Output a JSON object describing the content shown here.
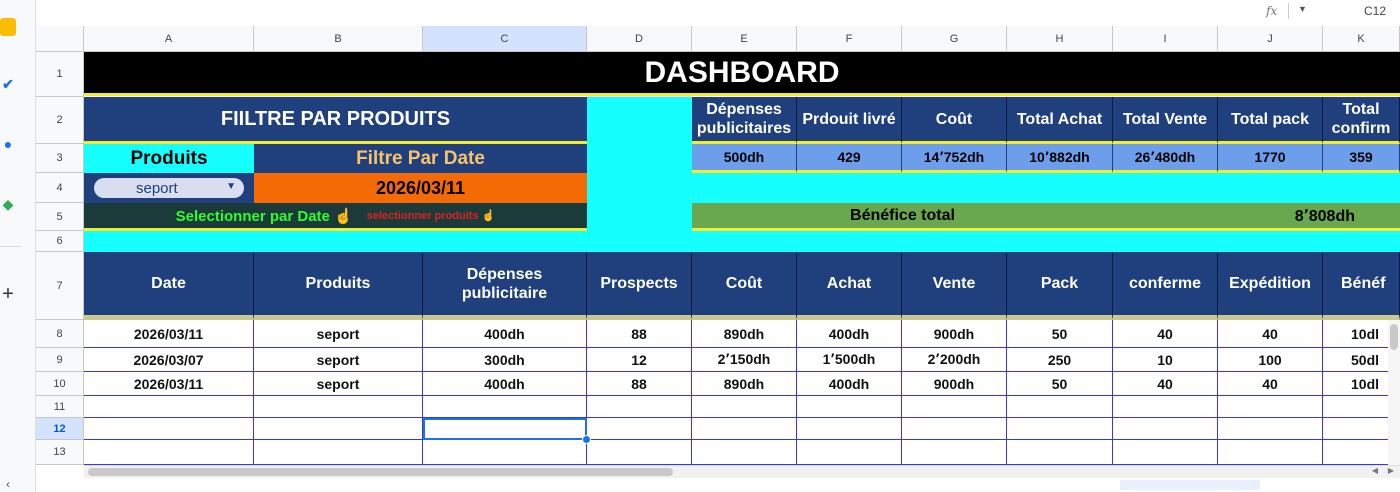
{
  "toolbar": {
    "fx_label": "fx",
    "cell_ref": "C12"
  },
  "sidebar": {
    "icons": [
      "keep-icon",
      "tasks-icon",
      "contacts-icon",
      "maps-icon",
      "add-icon",
      "collapse-icon"
    ]
  },
  "columns": [
    "A",
    "B",
    "C",
    "D",
    "E",
    "F",
    "G",
    "H",
    "I",
    "J",
    "K"
  ],
  "rows": [
    "1",
    "2",
    "3",
    "4",
    "5",
    "6",
    "7",
    "8",
    "9",
    "10",
    "11",
    "12",
    "13"
  ],
  "dashboard": {
    "title": "DASHBOARD",
    "filter_title": "FIILTRE PAR PRODUITS",
    "produits_label": "Produits",
    "date_filter_label": "Filtre Par Date",
    "product_select": "seport",
    "date_value": "2026/03/11",
    "select_by_date": "Selectionner par Date ☝",
    "select_products": "selectionner produits ☝",
    "benefit_label": "Bénéfice total",
    "benefit_value": "8٬808dh",
    "kpi_headers": [
      "Dépenses publicitaires",
      "Prdouit livré",
      "Coût",
      "Total Achat",
      "Total Vente",
      "Total pack",
      "Total confirm"
    ],
    "kpi_values": [
      "500dh",
      "429",
      "14٬752dh",
      "10٬882dh",
      "26٬480dh",
      "1770",
      "359"
    ]
  },
  "table": {
    "headers": [
      "Date",
      "Produits",
      "Dépenses publicitaire",
      "Prospects",
      "Coût",
      "Achat",
      "Vente",
      "Pack",
      "conferme",
      "Expédition",
      "Bénéf"
    ],
    "rows": [
      [
        "2026/03/11",
        "seport",
        "400dh",
        "88",
        "890dh",
        "400dh",
        "900dh",
        "50",
        "40",
        "40",
        "10dl"
      ],
      [
        "2026/03/07",
        "seport",
        "300dh",
        "12",
        "2٬150dh",
        "1٬500dh",
        "2٬200dh",
        "250",
        "10",
        "100",
        "50dl"
      ],
      [
        "2026/03/11",
        "seport",
        "400dh",
        "88",
        "890dh",
        "400dh",
        "900dh",
        "50",
        "40",
        "40",
        "10dl"
      ]
    ]
  },
  "colors": {
    "navy": "#1f3f7d",
    "cyan": "#16ffff",
    "orange": "#f46a05",
    "green": "#6aa84f",
    "kpi": "#6d9eeb"
  }
}
